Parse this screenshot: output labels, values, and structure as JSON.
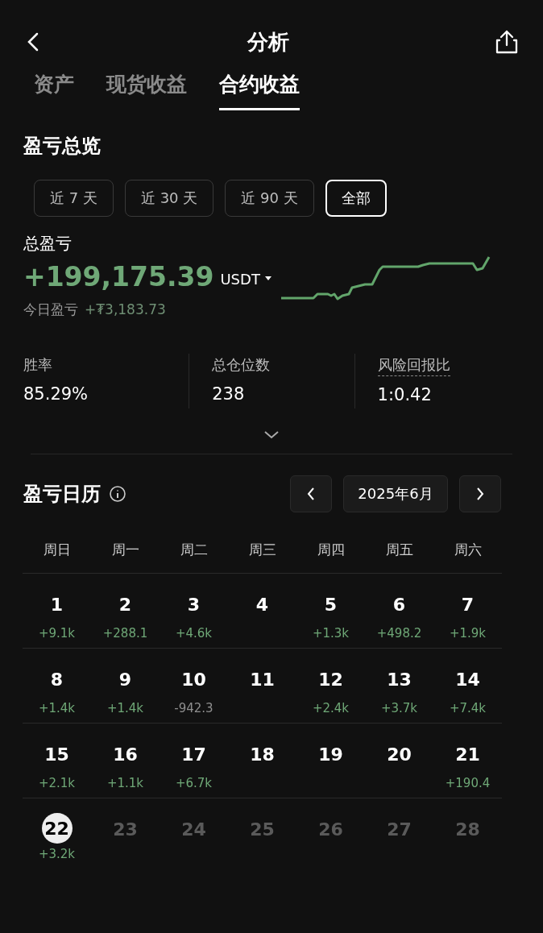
{
  "header": {
    "title": "分析"
  },
  "tabs": [
    {
      "label": "资产",
      "selected": false
    },
    {
      "label": "现货收益",
      "selected": false
    },
    {
      "label": "合约收益",
      "selected": true
    }
  ],
  "overview": {
    "title": "盈亏总览",
    "ranges": [
      {
        "label": "近 7 天",
        "selected": false
      },
      {
        "label": "近 30 天",
        "selected": false
      },
      {
        "label": "近 90 天",
        "selected": false
      },
      {
        "label": "全部",
        "selected": true
      }
    ],
    "total_label": "总盈亏",
    "total": "+199,175.39",
    "currency": "USDT",
    "today_label": "今日盈亏",
    "today_value": "+₮3,183.73",
    "stats": [
      {
        "label": "胜率",
        "value": "85.29%",
        "dashed": false
      },
      {
        "label": "总仓位数",
        "value": "238",
        "dashed": false
      },
      {
        "label": "风险回报比",
        "value": "1:0.42",
        "dashed": true
      }
    ]
  },
  "calendar": {
    "title": "盈亏日历",
    "month": "2025年6月",
    "weekdays": [
      "周日",
      "周一",
      "周二",
      "周三",
      "周四",
      "周五",
      "周六"
    ],
    "days": [
      {
        "day": "1",
        "pnl": "+9.1k",
        "color": "#6fa877",
        "kind": "past"
      },
      {
        "day": "2",
        "pnl": "+288.1",
        "color": "#6fa877",
        "kind": "past"
      },
      {
        "day": "3",
        "pnl": "+4.6k",
        "color": "#6fa877",
        "kind": "past"
      },
      {
        "day": "4",
        "kind": "past"
      },
      {
        "day": "5",
        "pnl": "+1.3k",
        "color": "#6fa877",
        "kind": "past"
      },
      {
        "day": "6",
        "pnl": "+498.2",
        "color": "#6fa877",
        "kind": "past"
      },
      {
        "day": "7",
        "pnl": "+1.9k",
        "color": "#6fa877",
        "kind": "past"
      },
      {
        "day": "8",
        "pnl": "+1.4k",
        "color": "#6fa877",
        "kind": "past"
      },
      {
        "day": "9",
        "pnl": "+1.4k",
        "color": "#6fa877",
        "kind": "past"
      },
      {
        "day": "10",
        "pnl": "-942.3",
        "color": "#8f8f8f",
        "kind": "past"
      },
      {
        "day": "11",
        "kind": "past"
      },
      {
        "day": "12",
        "pnl": "+2.4k",
        "color": "#6fa877",
        "kind": "past"
      },
      {
        "day": "13",
        "pnl": "+3.7k",
        "color": "#6fa877",
        "kind": "past"
      },
      {
        "day": "14",
        "pnl": "+7.4k",
        "color": "#6fa877",
        "kind": "past"
      },
      {
        "day": "15",
        "pnl": "+2.1k",
        "color": "#6fa877",
        "kind": "past"
      },
      {
        "day": "16",
        "pnl": "+1.1k",
        "color": "#6fa877",
        "kind": "past"
      },
      {
        "day": "17",
        "pnl": "+6.7k",
        "color": "#6fa877",
        "kind": "past"
      },
      {
        "day": "18",
        "kind": "past"
      },
      {
        "day": "19",
        "kind": "past"
      },
      {
        "day": "20",
        "kind": "past"
      },
      {
        "day": "21",
        "pnl": "+190.4",
        "color": "#6fa877",
        "kind": "past"
      },
      {
        "day": "22",
        "pnl": "+3.2k",
        "color": "#6fa877",
        "kind": "today"
      },
      {
        "day": "23",
        "kind": "future"
      },
      {
        "day": "24",
        "kind": "future"
      },
      {
        "day": "25",
        "kind": "future"
      },
      {
        "day": "26",
        "kind": "future"
      },
      {
        "day": "27",
        "kind": "future"
      },
      {
        "day": "28",
        "kind": "future"
      }
    ]
  }
}
